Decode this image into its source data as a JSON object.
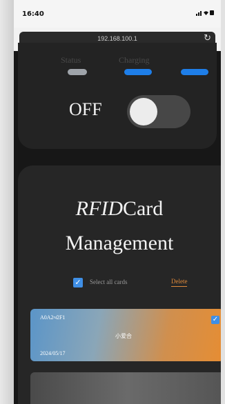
{
  "status_bar": {
    "time": "16:40",
    "icons": "signal-wifi-battery"
  },
  "browser": {
    "url": "192.168.100.1",
    "reload_icon": "reload-icon"
  },
  "top_panel": {
    "tabs": [
      {
        "label": "Status",
        "color": "#9fa4aa"
      },
      {
        "label": "Charging",
        "color": "#1e7ee8"
      },
      {
        "label": "",
        "color": "#1e7ee8"
      }
    ],
    "power_label": "OFF",
    "toggle_on": false
  },
  "rfid": {
    "title_italic": "RFID",
    "title_rest": "Card",
    "title_line2": "Management",
    "select_all_label": "Select all cards",
    "select_all_checked": true,
    "delete_label": "Delete",
    "cards": [
      {
        "uid": "A0A2≉2F1",
        "name": "小爱合",
        "date": "2024/05/17",
        "checked": true
      }
    ]
  },
  "colors": {
    "accent": "#1e7ee8",
    "delete": "#e08a3a",
    "checkbox": "#3f8fe6"
  }
}
